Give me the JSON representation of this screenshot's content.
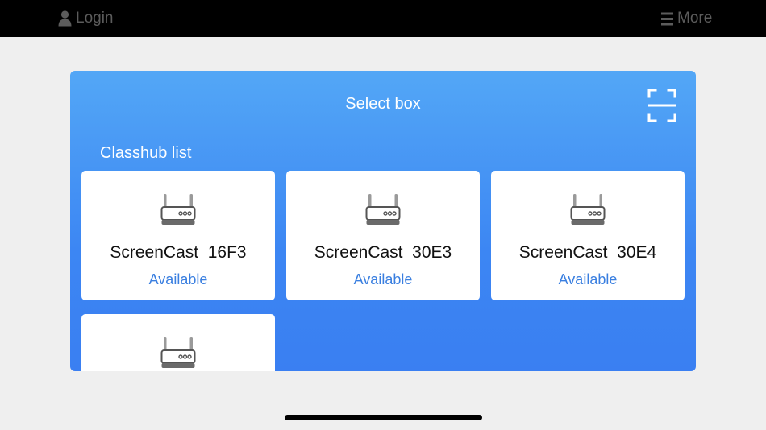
{
  "topbar": {
    "login_label": "Login",
    "more_label": "More"
  },
  "panel": {
    "title": "Select box",
    "section_label": "Classhub list"
  },
  "devices": [
    {
      "name": "ScreenCast  16F3",
      "status": "Available"
    },
    {
      "name": "ScreenCast  30E3",
      "status": "Available"
    },
    {
      "name": "ScreenCast  30E4",
      "status": "Available"
    },
    {
      "name": "",
      "status": ""
    }
  ],
  "colors": {
    "topbar_bg": "#000000",
    "page_bg": "#efefef",
    "panel_gradient_top": "#53a7f6",
    "panel_gradient_bottom": "#3a7ff2",
    "status_text": "#3a7fe0"
  },
  "icons": {
    "login": "person-icon",
    "more": "menu-icon",
    "scan": "scan-icon",
    "device": "router-icon"
  }
}
